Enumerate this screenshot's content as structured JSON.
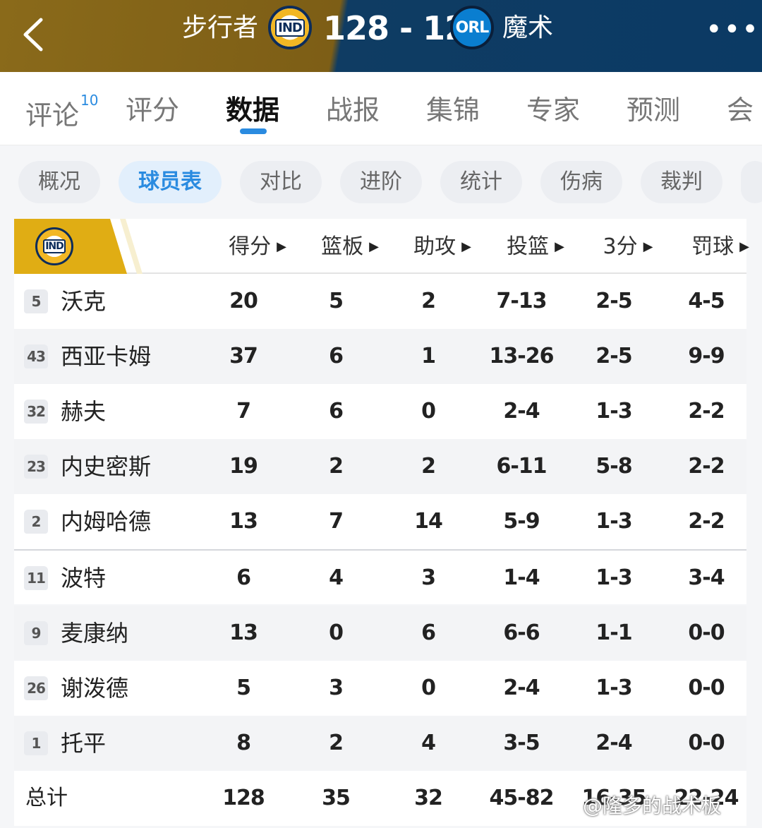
{
  "header": {
    "home_team": "步行者",
    "home_abbr": "IND",
    "score": "128 - 126",
    "away_team": "魔术",
    "away_abbr": "ORL",
    "more": "•••"
  },
  "main_tabs": [
    {
      "label": "评论",
      "badge": "10"
    },
    {
      "label": "评分"
    },
    {
      "label": "数据",
      "active": true
    },
    {
      "label": "战报"
    },
    {
      "label": "集锦"
    },
    {
      "label": "专家"
    },
    {
      "label": "预测"
    },
    {
      "label": "会"
    }
  ],
  "sub_tabs": [
    {
      "label": "概况"
    },
    {
      "label": "球员表",
      "active": true
    },
    {
      "label": "对比"
    },
    {
      "label": "进阶"
    },
    {
      "label": "统计"
    },
    {
      "label": "伤病"
    },
    {
      "label": "裁判"
    }
  ],
  "table": {
    "team_logo": "IND",
    "columns": [
      "得分",
      "篮板",
      "助攻",
      "投篮",
      "3分",
      "罚球"
    ],
    "rows": [
      {
        "num": "5",
        "name": "沃克",
        "pts": "20",
        "reb": "5",
        "ast": "2",
        "fg": "7-13",
        "tp": "2-5",
        "ft": "4-5"
      },
      {
        "num": "43",
        "name": "西亚卡姆",
        "pts": "37",
        "reb": "6",
        "ast": "1",
        "fg": "13-26",
        "tp": "2-5",
        "ft": "9-9"
      },
      {
        "num": "32",
        "name": "赫夫",
        "pts": "7",
        "reb": "6",
        "ast": "0",
        "fg": "2-4",
        "tp": "1-3",
        "ft": "2-2"
      },
      {
        "num": "23",
        "name": "内史密斯",
        "pts": "19",
        "reb": "2",
        "ast": "2",
        "fg": "6-11",
        "tp": "5-8",
        "ft": "2-2"
      },
      {
        "num": "2",
        "name": "内姆哈德",
        "pts": "13",
        "reb": "7",
        "ast": "14",
        "fg": "5-9",
        "tp": "1-3",
        "ft": "2-2"
      },
      {
        "num": "11",
        "name": "波特",
        "pts": "6",
        "reb": "4",
        "ast": "3",
        "fg": "1-4",
        "tp": "1-3",
        "ft": "3-4"
      },
      {
        "num": "9",
        "name": "麦康纳",
        "pts": "13",
        "reb": "0",
        "ast": "6",
        "fg": "6-6",
        "tp": "1-1",
        "ft": "0-0"
      },
      {
        "num": "26",
        "name": "谢泼德",
        "pts": "5",
        "reb": "3",
        "ast": "0",
        "fg": "2-4",
        "tp": "1-3",
        "ft": "0-0"
      },
      {
        "num": "1",
        "name": "托平",
        "pts": "8",
        "reb": "2",
        "ast": "4",
        "fg": "3-5",
        "tp": "2-4",
        "ft": "0-0"
      }
    ],
    "total": {
      "label": "总计",
      "pts": "128",
      "reb": "35",
      "ast": "32",
      "fg": "45-82",
      "tp": "16-35",
      "ft": "22-24"
    }
  },
  "watermark": "@隆多的战术板"
}
